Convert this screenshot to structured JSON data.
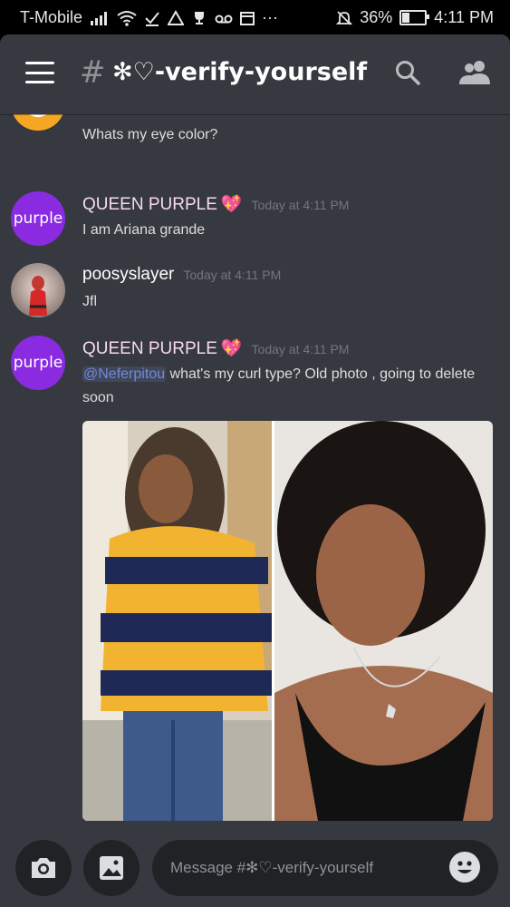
{
  "status_bar": {
    "carrier": "T-Mobile",
    "battery_percent": "36%",
    "battery_level": 0.36,
    "time": "4:11 PM",
    "overflow_indicator": "···"
  },
  "header": {
    "hash_symbol": "#",
    "channel_name": "✻♡-verify-yourself"
  },
  "messages": [
    {
      "text": "Whats my eye color?"
    },
    {
      "username": "QUEEN PURPLE",
      "username_color": "#f8d9ef",
      "badge": "💖",
      "timestamp": "Today at 4:11 PM",
      "avatar_label": "purple",
      "text": "I am Ariana grande"
    },
    {
      "username": "poosyslayer",
      "username_color": "#ffffff",
      "timestamp": "Today at 4:11 PM",
      "text": "Jfl"
    },
    {
      "username": "QUEEN PURPLE",
      "username_color": "#f8d9ef",
      "badge": "💖",
      "timestamp": "Today at 4:11 PM",
      "avatar_label": "purple",
      "mention": "@Neferpitou",
      "text": " what's my curl type? Old photo , going to delete soon"
    }
  ],
  "composer": {
    "placeholder": "Message #✻♡-verify-yourself"
  },
  "colors": {
    "background": "#36393f",
    "input_bg": "#202225",
    "accent_purple": "#8a2be2",
    "mention_blue": "#7289da"
  }
}
